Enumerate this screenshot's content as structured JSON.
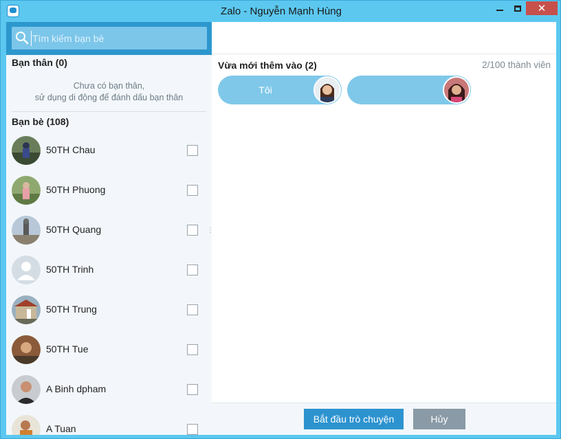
{
  "window": {
    "title": "Zalo - Nguyễn Mạnh Hùng",
    "app_icon": "zalo-logo-icon",
    "close_glyph": "✕"
  },
  "search": {
    "placeholder": "Tìm kiếm bạn bè",
    "value": ""
  },
  "best_friends": {
    "heading": "Bạn thân (0)",
    "empty_line1": "Chưa có bạn thân,",
    "empty_line2": "sử dụng di động để đánh dấu bạn thân"
  },
  "friends": {
    "heading": "Bạn bè (108)",
    "items": [
      {
        "name": "50TH Chau",
        "checked": false,
        "avatar": "photo-avatar"
      },
      {
        "name": "50TH Phuong",
        "checked": false,
        "avatar": "photo-avatar"
      },
      {
        "name": "50TH Quang",
        "checked": false,
        "avatar": "photo-avatar"
      },
      {
        "name": "50TH Trinh",
        "checked": false,
        "avatar": "default-user-avatar"
      },
      {
        "name": "50TH Trung",
        "checked": false,
        "avatar": "photo-avatar"
      },
      {
        "name": "50TH Tue",
        "checked": false,
        "avatar": "photo-avatar"
      },
      {
        "name": "A Binh dpham",
        "checked": false,
        "avatar": "photo-avatar"
      },
      {
        "name": "A Tuan",
        "checked": false,
        "avatar": "photo-avatar"
      }
    ]
  },
  "recent": {
    "heading": "Vừa mới thêm vào (2)",
    "member_count": "2/100 thành viên",
    "members": [
      {
        "label": "Tôi"
      },
      {
        "label": ""
      }
    ]
  },
  "footer": {
    "start_label": "Bắt đầu trò chuyện",
    "cancel_label": "Hủy"
  },
  "colors": {
    "frame": "#5cc8f0",
    "search_bar": "#2c97cd",
    "chip": "#7fc8ea",
    "primary_button": "#2d93cf",
    "secondary_button": "#8a9aa6",
    "close_button": "#c7504b"
  }
}
